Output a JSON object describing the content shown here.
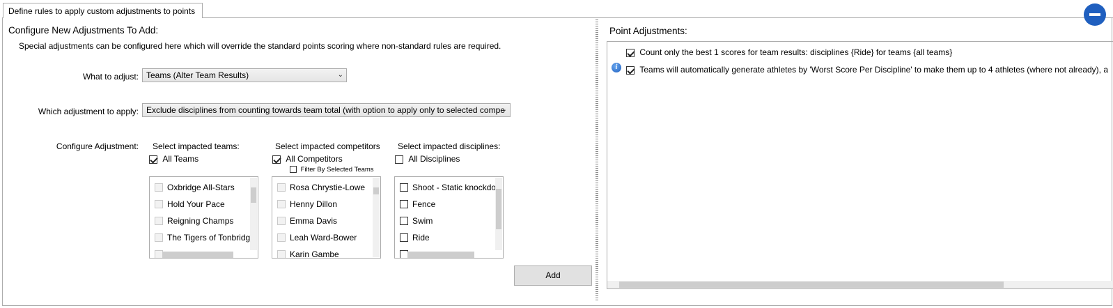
{
  "tab": {
    "label": "Define rules to apply custom adjustments to points"
  },
  "left": {
    "heading": "Configure New Adjustments To Add:",
    "description": "Special adjustments can be configured here which will override the standard points scoring where non-standard rules are required.",
    "what_label": "What to adjust:",
    "what_value": "Teams (Alter Team Results)",
    "which_label": "Which adjustment to apply:",
    "which_value": "Exclude disciplines from counting towards team total (with option to apply only to selected compe",
    "configure_label": "Configure Adjustment:",
    "teams": {
      "header": "Select impacted teams:",
      "all_label": "All Teams",
      "all_checked": true,
      "items": [
        "Oxbridge All-Stars",
        "Hold Your Pace",
        "Reigning Champs",
        "The Tigers of Tonbridge"
      ]
    },
    "competitors": {
      "header": "Select impacted competitors",
      "all_label": "All Competitors",
      "all_checked": true,
      "filter_label": "Filter By Selected Teams",
      "items": [
        "Rosa Chrystie-Lowe",
        "Henny Dillon",
        "Emma Davis",
        "Leah Ward-Bower",
        "Karin Gambe"
      ]
    },
    "disciplines": {
      "header": "Select impacted disciplines:",
      "all_label": "All Disciplines",
      "all_checked": false,
      "items": [
        "Shoot - Static knockdown",
        "Fence",
        "Swim",
        "Ride"
      ]
    },
    "add_button": "Add"
  },
  "right": {
    "heading": "Point Adjustments:",
    "items": [
      {
        "text": "Count only the best 1 scores for team results: disciplines {Ride} for teams {all teams}",
        "checked": true,
        "info": false
      },
      {
        "text": "Teams will automatically generate athletes by 'Worst Score Per Discipline' to make them up to 4 athletes (where not already), a",
        "checked": true,
        "info": true
      }
    ]
  },
  "icons": [
    "info-icon",
    "collapse-icon",
    "dropdown-arrow-icon"
  ]
}
